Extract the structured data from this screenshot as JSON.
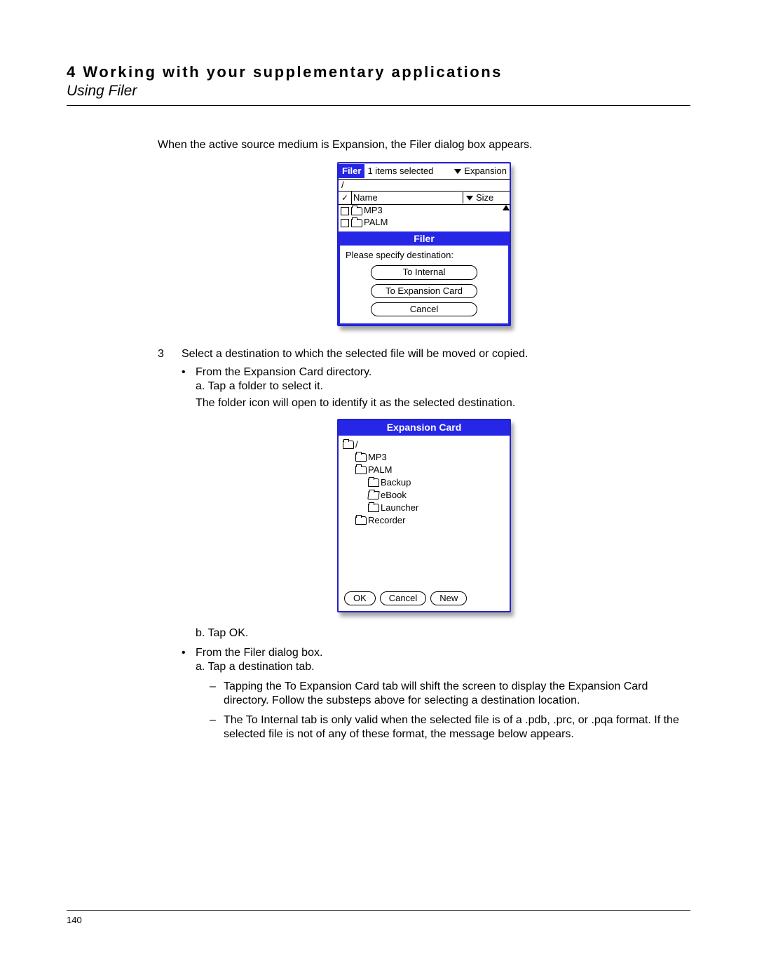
{
  "header": {
    "chapter": "4 Working with your supplementary applications",
    "section": "Using Filer"
  },
  "intro_text": "When the active source medium is Expansion, the Filer dialog box appears.",
  "screenshot1": {
    "app_tag": "Filer",
    "status": "1 items selected",
    "medium": "Expansion",
    "path": "/",
    "col_name": "Name",
    "col_size": "Size",
    "rows": [
      "MP3",
      "PALM"
    ],
    "dialog_title": "Filer",
    "dialog_prompt": "Please specify destination:",
    "btn_internal": "To Internal",
    "btn_expansion": "To Expansion Card",
    "btn_cancel": "Cancel"
  },
  "step3": {
    "num": "3",
    "text": "Select a destination to which the selected file will be moved or copied.",
    "bullet1": "From the Expansion Card directory.",
    "sub_a": "a. Tap a folder to select it.",
    "sub_a_note": "The folder icon will open to identify it as the selected destination.",
    "sub_b": "b. Tap OK.",
    "bullet2": "From the Filer dialog box.",
    "sub2_a": "a. Tap a destination tab.",
    "dash1": "Tapping the To Expansion Card tab will shift the screen to display the Expansion Card directory. Follow the substeps above for selecting a destination location.",
    "dash2": "The To Internal tab is only valid when the selected file is of a .pdb, .prc, or .pqa format. If the selected file is not of any of these format, the message below appears."
  },
  "screenshot2": {
    "title": "Expansion Card",
    "tree": [
      {
        "indent": 0,
        "label": "/",
        "open": false
      },
      {
        "indent": 1,
        "label": "MP3",
        "open": false
      },
      {
        "indent": 1,
        "label": "PALM",
        "open": false
      },
      {
        "indent": 2,
        "label": "Backup",
        "open": false
      },
      {
        "indent": 2,
        "label": "eBook",
        "open": true
      },
      {
        "indent": 2,
        "label": "Launcher",
        "open": false
      },
      {
        "indent": 1,
        "label": "Recorder",
        "open": false
      }
    ],
    "btn_ok": "OK",
    "btn_cancel": "Cancel",
    "btn_new": "New"
  },
  "page_number": "140"
}
